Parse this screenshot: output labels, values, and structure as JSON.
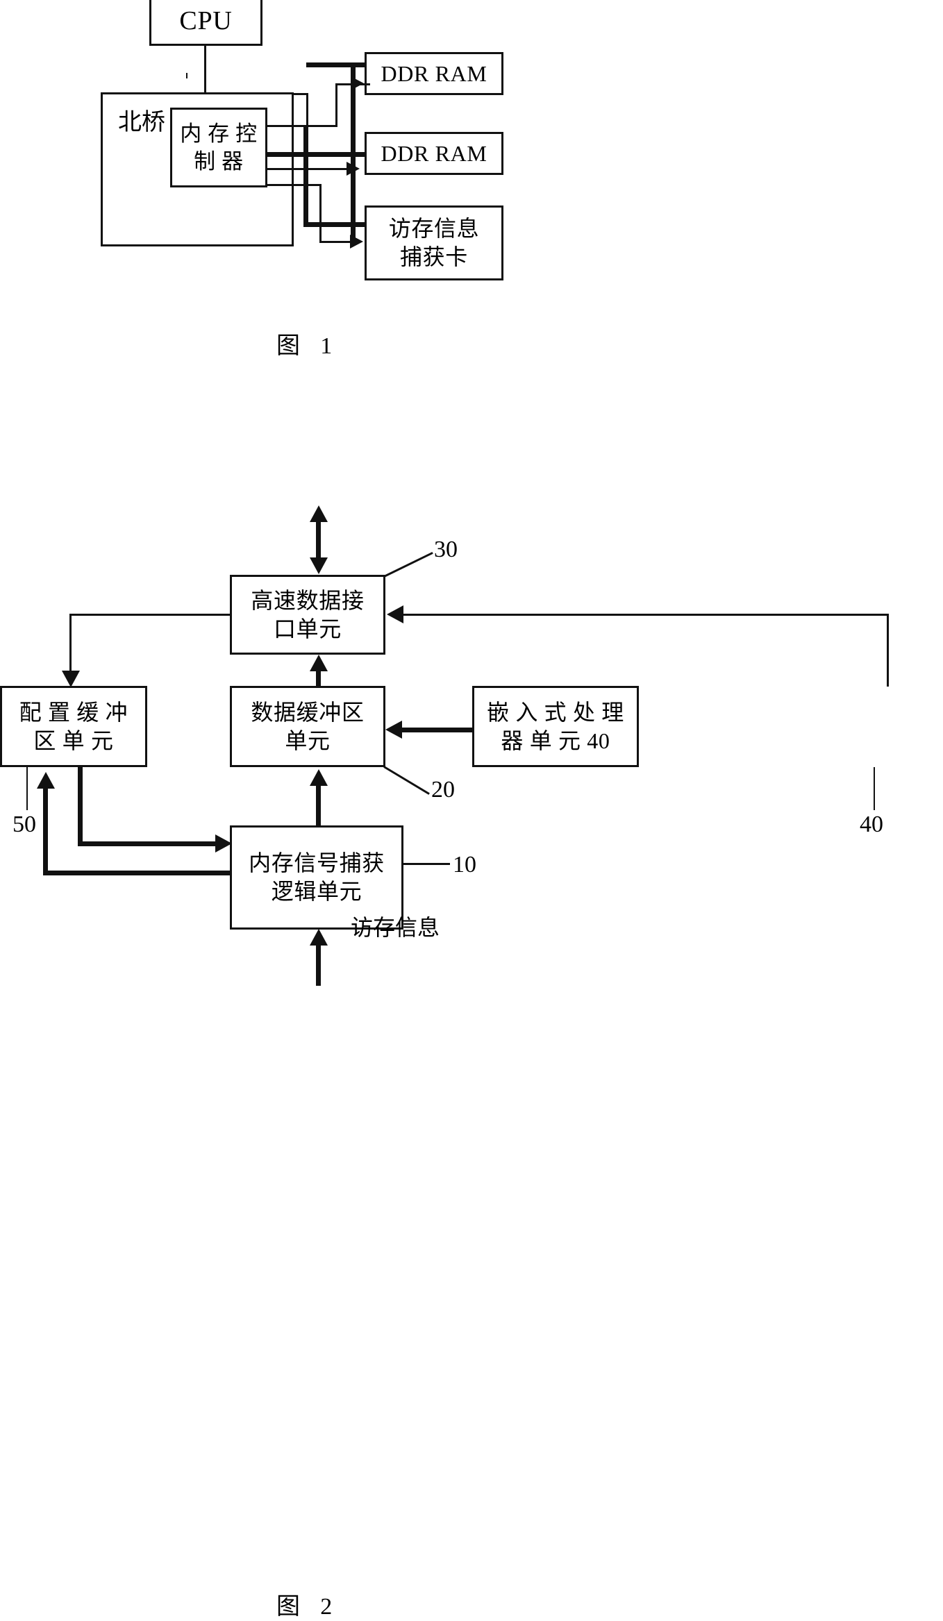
{
  "document": {
    "kind": "patent-figure-sheet",
    "figures": [
      {
        "id": "fig1",
        "caption": "图  1",
        "blocks": {
          "cpu": "CPU",
          "northbridge": "北桥",
          "memory_controller": "内 存 控\n制 器",
          "ddr_ram_1": "DDR RAM",
          "ddr_ram_2": "DDR RAM",
          "capture_card": "访存信息\n捕获卡"
        }
      },
      {
        "id": "fig2",
        "caption": "图  2",
        "blocks": {
          "high_speed_interface": "高速数据接\n口单元",
          "config_buffer": "配 置 缓 冲\n区 单 元",
          "data_buffer": "数据缓冲区\n单元",
          "embedded_processor": "嵌 入 式 处 理\n器 单 元 40",
          "capture_logic": "内存信号捕获\n逻辑单元"
        },
        "reference_numerals": {
          "interface_unit": "30",
          "data_buffer_unit": "20",
          "capture_logic_unit": "10",
          "embedded_processor_unit": "40",
          "config_buffer_unit": "50"
        },
        "annotations": {
          "input_signal": "访存信息"
        }
      }
    ]
  }
}
